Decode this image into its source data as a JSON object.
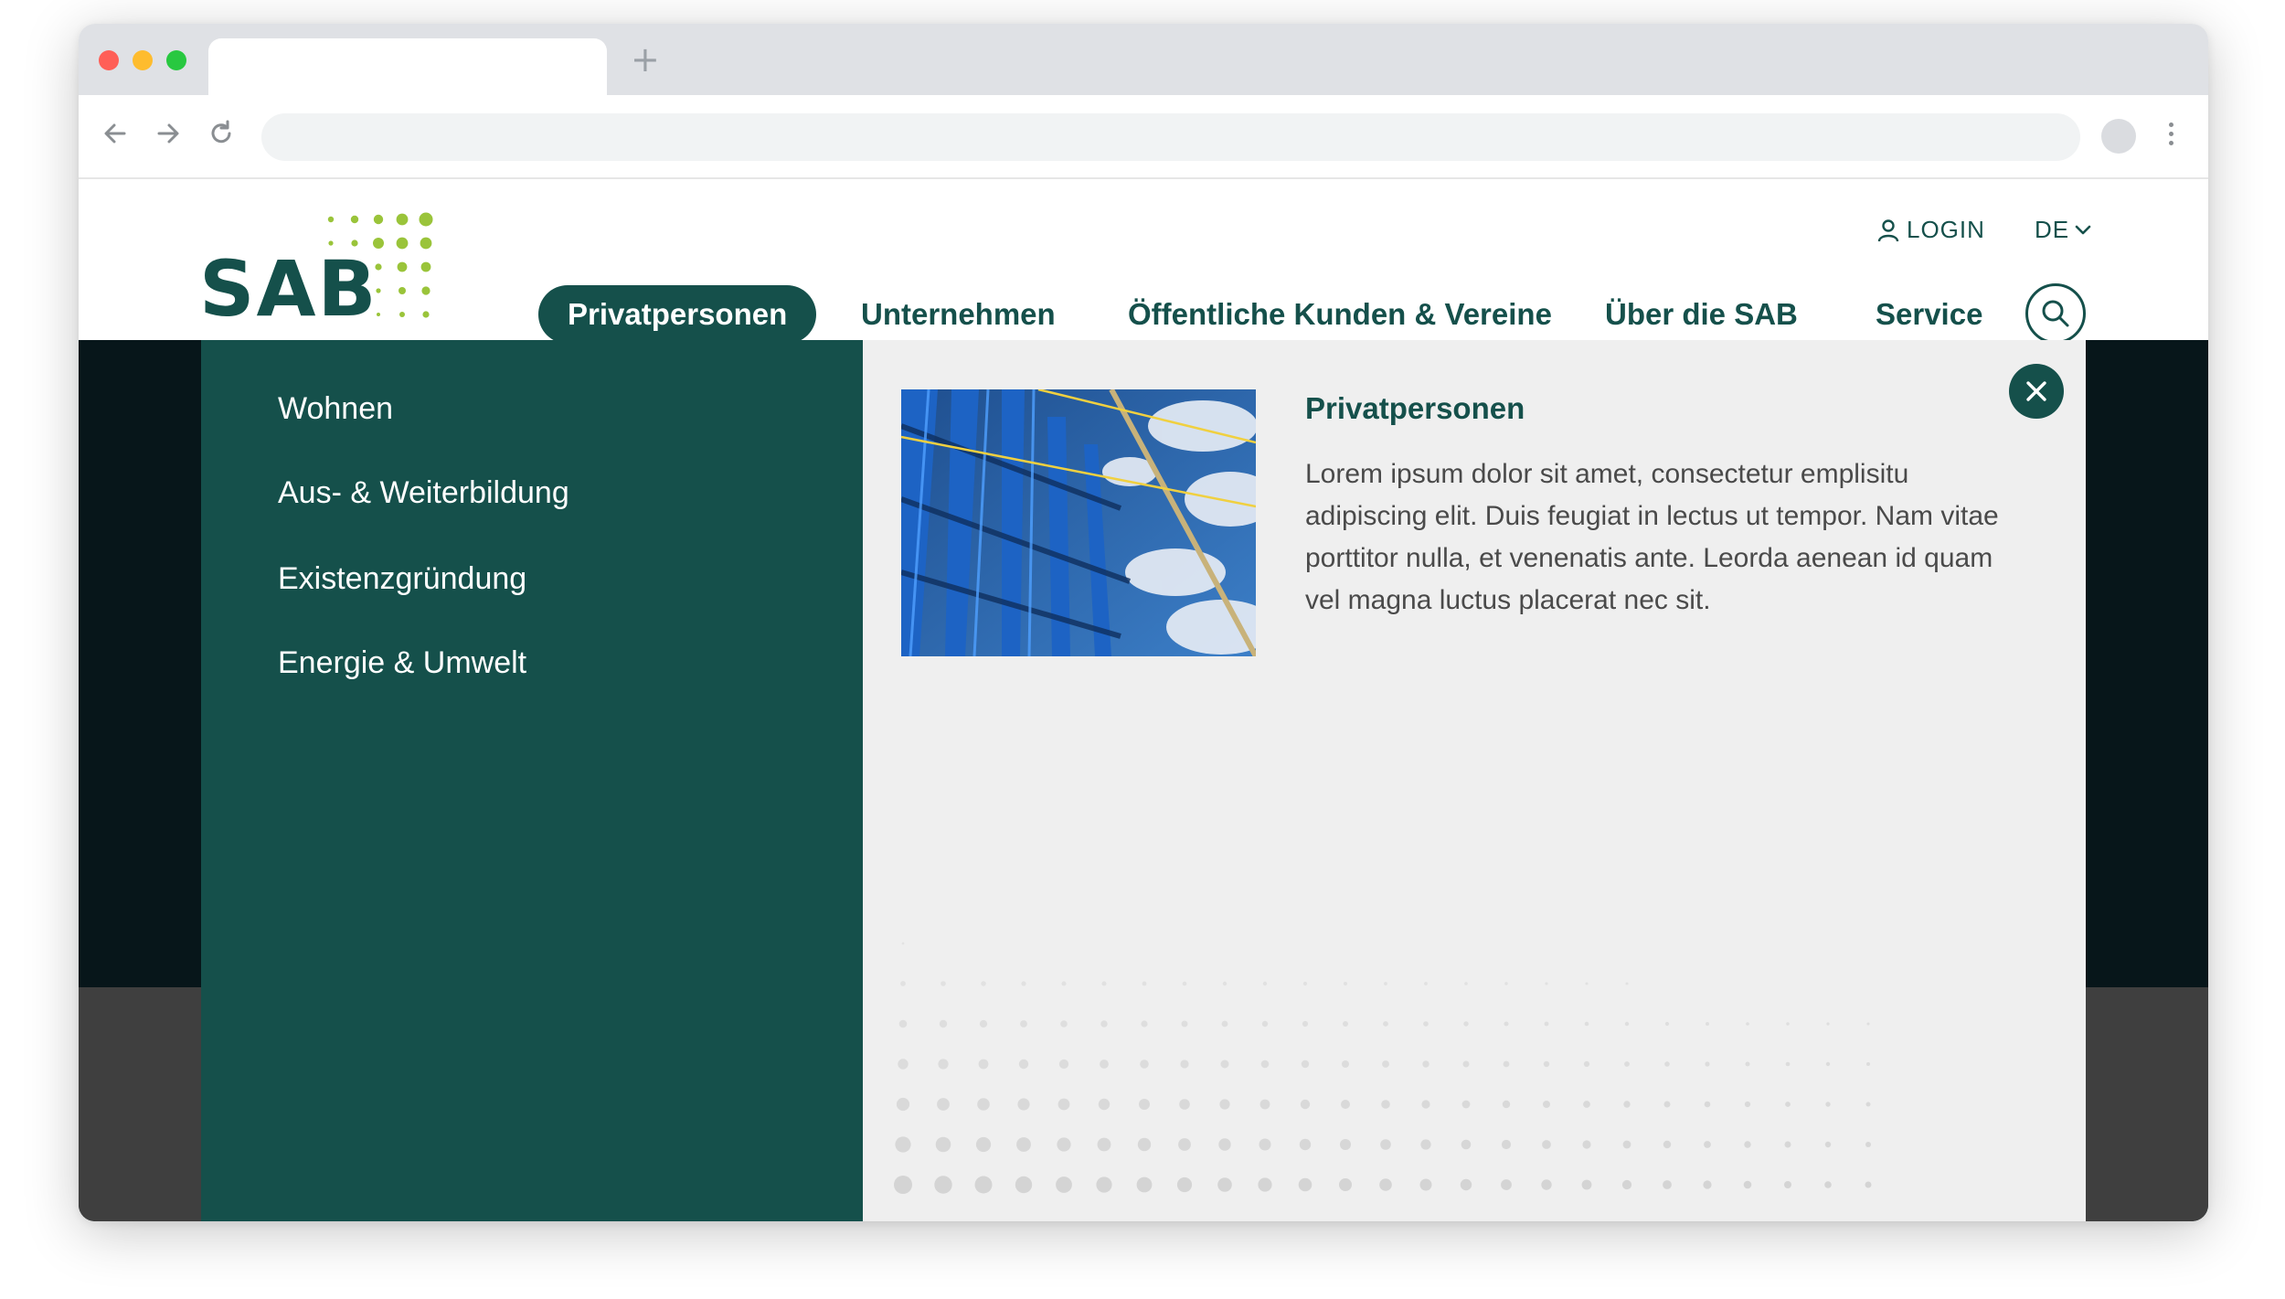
{
  "browser": {
    "new_tab_symbol": "+"
  },
  "site": {
    "logo_text": "SAB",
    "brand_color": "#15504b",
    "accent_color": "#9ac43a",
    "utility": {
      "login_label": "LOGIN",
      "login_icon": "user-icon",
      "language_label": "DE",
      "language_icon": "chevron-down-icon"
    },
    "nav": {
      "items": [
        {
          "label": "Privatpersonen",
          "active": true
        },
        {
          "label": "Unternehmen",
          "active": false
        },
        {
          "label": "Öffentliche Kunden & Vereine",
          "active": false
        },
        {
          "label": "Über die SAB",
          "active": false
        },
        {
          "label": "Service",
          "active": false
        }
      ],
      "search_icon": "search-icon"
    }
  },
  "mega_menu": {
    "links": [
      {
        "label": "Wohnen"
      },
      {
        "label": "Aus- & Weiterbildung"
      },
      {
        "label": "Existenzgründung"
      },
      {
        "label": "Energie & Umwelt"
      }
    ],
    "teaser": {
      "title": "Privatpersonen",
      "text": "Lorem ipsum dolor sit amet, consectetur emplisitu adipiscing elit. Duis feugiat in lectus ut tempor. Nam vitae porttitor nulla, et venenatis ante. Leorda aenean id quam vel magna luctus placerat nec sit.",
      "image_icon": "steel-structure-image"
    },
    "close_icon": "close-icon"
  }
}
